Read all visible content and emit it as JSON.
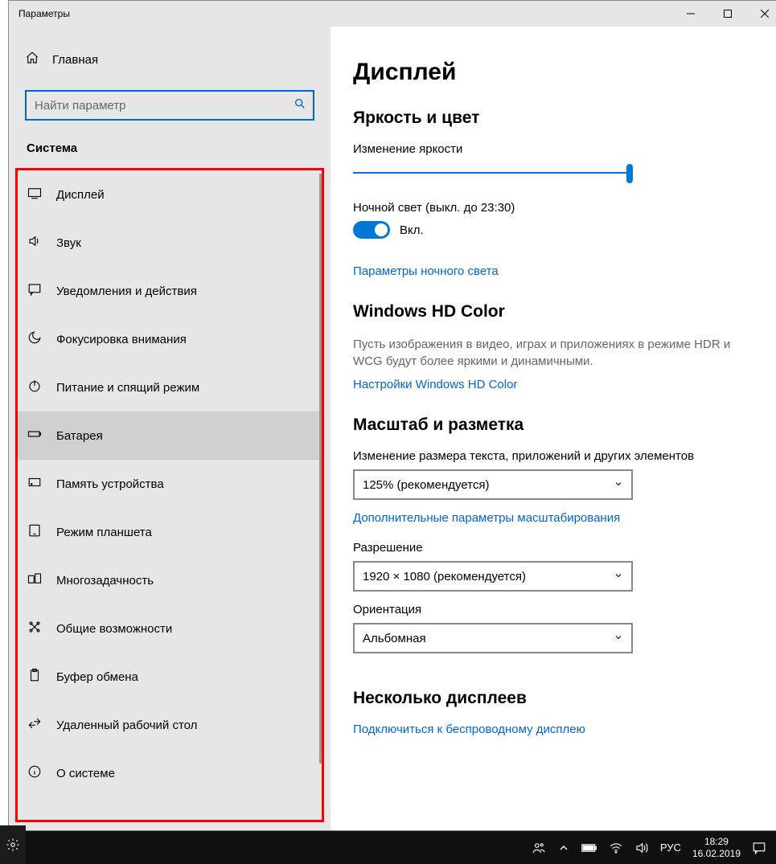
{
  "titlebar": {
    "title": "Параметры"
  },
  "sidebar": {
    "home": "Главная",
    "search_placeholder": "Найти параметр",
    "section": "Система",
    "items": [
      {
        "label": "Дисплей"
      },
      {
        "label": "Звук"
      },
      {
        "label": "Уведомления и действия"
      },
      {
        "label": "Фокусировка внимания"
      },
      {
        "label": "Питание и спящий режим"
      },
      {
        "label": "Батарея"
      },
      {
        "label": "Память устройства"
      },
      {
        "label": "Режим планшета"
      },
      {
        "label": "Многозадачность"
      },
      {
        "label": "Общие возможности"
      },
      {
        "label": "Буфер обмена"
      },
      {
        "label": "Удаленный рабочий стол"
      },
      {
        "label": "О системе"
      }
    ]
  },
  "main": {
    "title": "Дисплей",
    "brightness": {
      "heading": "Яркость и цвет",
      "label": "Изменение яркости",
      "nightlight_label": "Ночной свет (выкл. до 23:30)",
      "toggle_label": "Вкл.",
      "nightlight_link": "Параметры ночного света"
    },
    "hdcolor": {
      "heading": "Windows HD Color",
      "desc": "Пусть изображения в видео, играх и приложениях в режиме HDR и WCG будут более яркими и динамичными.",
      "link": "Настройки Windows HD Color"
    },
    "scale": {
      "heading": "Масштаб и разметка",
      "size_label": "Изменение размера текста, приложений и других элементов",
      "size_value": "125% (рекомендуется)",
      "adv_link": "Дополнительные параметры масштабирования",
      "res_label": "Разрешение",
      "res_value": "1920 × 1080 (рекомендуется)",
      "orient_label": "Ориентация",
      "orient_value": "Альбомная"
    },
    "multi": {
      "heading": "Несколько дисплеев",
      "link": "Подключиться к беспроводному дисплею"
    }
  },
  "taskbar": {
    "lang": "РУС",
    "time": "18:29",
    "date": "16.02.2019"
  }
}
